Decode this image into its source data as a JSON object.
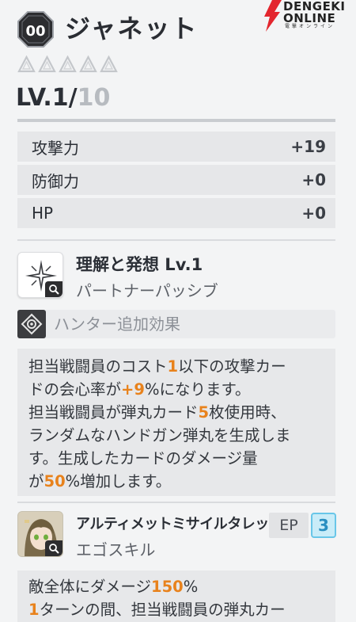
{
  "header": {
    "rarity_badge": "00",
    "character_name": "ジャネット"
  },
  "logo": {
    "line1": "DENGEKI",
    "line2": "ONLINE",
    "line3": "電撃オンライン"
  },
  "stars": {
    "filled": 0,
    "total": 5
  },
  "level": {
    "current": "LV.1/",
    "max": "10"
  },
  "stats": [
    {
      "label": "攻撃力",
      "value": "+19"
    },
    {
      "label": "防御力",
      "value": "+0"
    },
    {
      "label": "HP",
      "value": "+0"
    }
  ],
  "passive": {
    "name": "理解と発想 Lv.1",
    "type": "パートナーパッシブ",
    "hunter_bonus_label": "ハンター追加効果",
    "description_lines": [
      [
        {
          "t": "担当戦闘員のコスト"
        },
        {
          "t": "1",
          "hl": true
        },
        {
          "t": "以下の攻撃カー"
        }
      ],
      [
        {
          "t": "ドの会心率が"
        },
        {
          "t": "+9",
          "hl": true
        },
        {
          "t": "%になります。"
        }
      ],
      [
        {
          "t": "担当戦闘員が弾丸カード"
        },
        {
          "t": "5",
          "hl": true
        },
        {
          "t": "枚使用時、"
        }
      ],
      [
        {
          "t": "ランダムなハンドガン弾丸を生成しま"
        }
      ],
      [
        {
          "t": "す。生成したカードのダメージ量"
        }
      ],
      [
        {
          "t": "が"
        },
        {
          "t": "50",
          "hl": true
        },
        {
          "t": "%増加します。"
        }
      ]
    ]
  },
  "ego_skill": {
    "name": "アルティメットミサイルタレット！",
    "type": "エゴスキル",
    "ep_label": "EP",
    "ep_value": "3",
    "description_lines": [
      [
        {
          "t": "敵全体にダメージ"
        },
        {
          "t": "150",
          "hl": true
        },
        {
          "t": "%"
        }
      ],
      [
        {
          "t": "1",
          "hl": true
        },
        {
          "t": "ターンの間、担当戦闘員の弾丸カー"
        }
      ]
    ]
  },
  "colors": {
    "highlight": "#e8821c",
    "ep_accent": "#69c6e8",
    "logo_red": "#e3262e"
  }
}
